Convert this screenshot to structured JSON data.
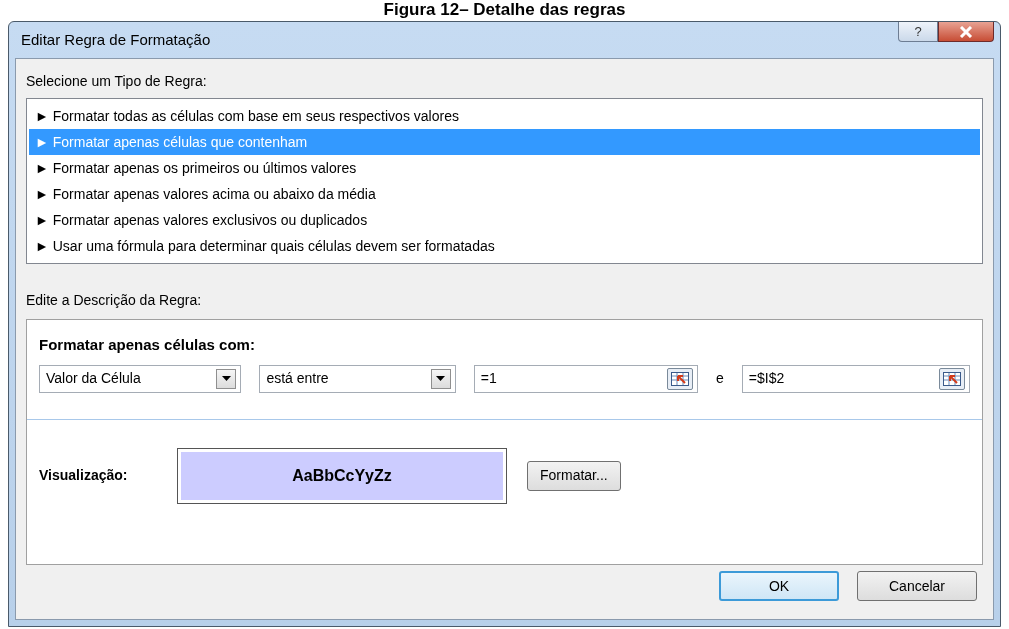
{
  "caption": "Figura 12– Detalhe das regras",
  "window": {
    "title": "Editar Regra de Formatação",
    "help": "?"
  },
  "rule_type": {
    "label": "Selecione um Tipo de Regra:",
    "items": [
      {
        "arrow": "►",
        "text": "Formatar todas as células com base em seus respectivos valores",
        "selected": false
      },
      {
        "arrow": "►",
        "text": "Formatar apenas células que contenham",
        "selected": true
      },
      {
        "arrow": "►",
        "text": "Formatar apenas os primeiros ou últimos valores",
        "selected": false
      },
      {
        "arrow": "►",
        "text": "Formatar apenas valores acima ou abaixo da média",
        "selected": false
      },
      {
        "arrow": "►",
        "text": "Formatar apenas valores exclusivos ou duplicados",
        "selected": false
      },
      {
        "arrow": "►",
        "text": "Usar uma fórmula para determinar quais células devem ser formatadas",
        "selected": false
      }
    ]
  },
  "description": {
    "label": "Edite a Descrição da Regra:",
    "heading": "Formatar apenas células com:",
    "fields": [
      {
        "kind": "select",
        "value": "Valor da Célula"
      },
      {
        "kind": "select",
        "value": "está entre"
      },
      {
        "kind": "ref",
        "value": "=1"
      },
      {
        "kind": "label",
        "text": "e"
      },
      {
        "kind": "ref",
        "value": "=$I$2"
      }
    ],
    "preview_label": "Visualização:",
    "preview_text": "AaBbCcYyZz",
    "format_button": "Formatar..."
  },
  "buttons": [
    {
      "label": "OK",
      "default": true
    },
    {
      "label": "Cancelar",
      "default": false
    }
  ]
}
